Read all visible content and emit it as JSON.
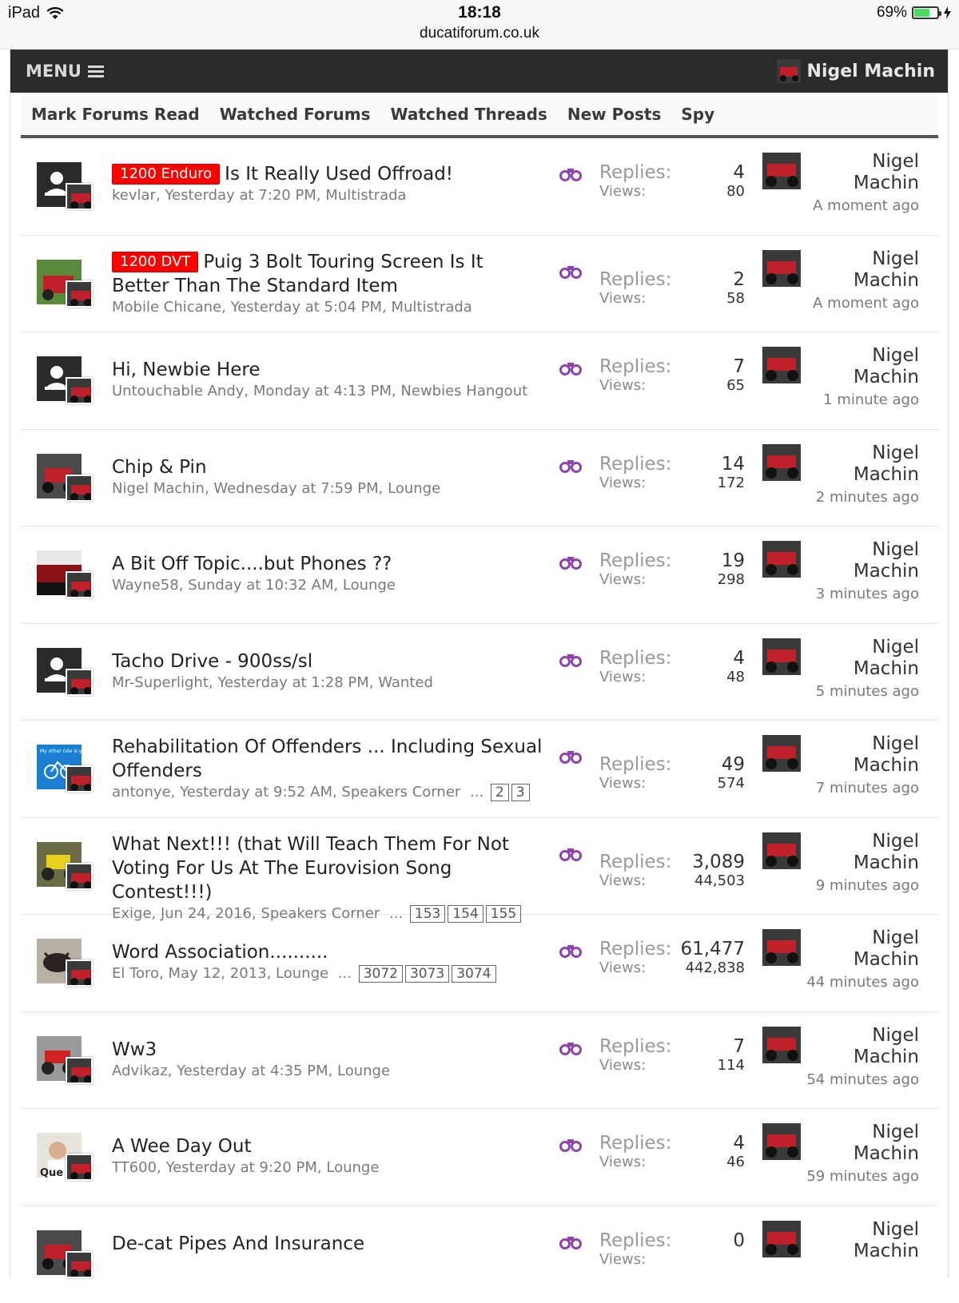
{
  "status": {
    "device": "iPad",
    "time": "18:18",
    "url": "ducatiforum.co.uk",
    "battery": "69%",
    "battery_level": 0.69
  },
  "nav": {
    "menu_label": "MENU",
    "user_name": "Nigel Machin"
  },
  "subnav": [
    "Mark Forums Read",
    "Watched Forums",
    "Watched Threads",
    "New Posts",
    "Spy"
  ],
  "labels": {
    "replies": "Replies:",
    "views": "Views:",
    "ellipsis": "..."
  },
  "threads": [
    {
      "prefix": "1200 Enduro",
      "title": "Is It Really Used Offroad!",
      "meta": "kevlar, Yesterday at 7:20 PM, Multistrada",
      "pages": [],
      "replies": "4",
      "views": "80",
      "last_first": "Nigel",
      "last_last": "Machin",
      "last_time": "A moment ago",
      "avatar": "default"
    },
    {
      "prefix": "1200 DVT",
      "title": "Puig 3 Bolt Touring Screen Is It Better Than The Standard Item",
      "meta": "Mobile Chicane, Yesterday at 5:04 PM, Multistrada",
      "pages": [],
      "replies": "2",
      "views": "58",
      "last_first": "Nigel",
      "last_last": "Machin",
      "last_time": "A moment ago",
      "avatar": "photo-green"
    },
    {
      "prefix": "",
      "title": "Hi, Newbie Here",
      "meta": "Untouchable Andy, Monday at 4:13 PM, Newbies Hangout",
      "pages": [],
      "replies": "7",
      "views": "65",
      "last_first": "Nigel",
      "last_last": "Machin",
      "last_time": "1 minute ago",
      "avatar": "default"
    },
    {
      "prefix": "",
      "title": "Chip & Pin",
      "meta": "Nigel Machin, Wednesday at 7:59 PM, Lounge",
      "pages": [],
      "replies": "14",
      "views": "172",
      "last_first": "Nigel",
      "last_last": "Machin",
      "last_time": "2 minutes ago",
      "avatar": "photo-red"
    },
    {
      "prefix": "",
      "title": "A Bit Off Topic....but Phones ??",
      "meta": "Wayne58, Sunday at 10:32 AM, Lounge",
      "pages": [],
      "replies": "19",
      "views": "298",
      "last_first": "Nigel",
      "last_last": "Machin",
      "last_time": "3 minutes ago",
      "avatar": "photo-car"
    },
    {
      "prefix": "",
      "title": "Tacho Drive - 900ss/sl",
      "meta": "Mr-Superlight, Yesterday at 1:28 PM, Wanted",
      "pages": [],
      "replies": "4",
      "views": "48",
      "last_first": "Nigel",
      "last_last": "Machin",
      "last_time": "5 minutes ago",
      "avatar": "default"
    },
    {
      "prefix": "",
      "title": "Rehabilitation Of Offenders ... Including Sexual Offenders",
      "meta": "antonye, Yesterday at 9:52 AM, Speakers Corner",
      "pages": [
        "2",
        "3"
      ],
      "replies": "49",
      "views": "574",
      "last_first": "Nigel",
      "last_last": "Machin",
      "last_time": "7 minutes ago",
      "avatar": "photo-blue",
      "avatar_text": "My other ride is your m"
    },
    {
      "prefix": "",
      "title": "What Next!!! (that Will Teach Them For Not Voting For Us At The Eurovision Song Contest!!!)",
      "meta": "Exige, Jun 24, 2016, Speakers Corner",
      "pages": [
        "153",
        "154",
        "155"
      ],
      "replies": "3,089",
      "views": "44,503",
      "last_first": "Nigel",
      "last_last": "Machin",
      "last_time": "9 minutes ago",
      "avatar": "photo-yellow"
    },
    {
      "prefix": "",
      "title": "Word Association..........",
      "meta": "El Toro, May 12, 2013, Lounge",
      "pages": [
        "3072",
        "3073",
        "3074"
      ],
      "replies": "61,477",
      "views": "442,838",
      "last_first": "Nigel",
      "last_last": "Machin",
      "last_time": "44 minutes ago",
      "avatar": "photo-bull"
    },
    {
      "prefix": "",
      "title": "Ww3",
      "meta": "Advikaz, Yesterday at 4:35 PM, Lounge",
      "pages": [],
      "replies": "7",
      "views": "114",
      "last_first": "Nigel",
      "last_last": "Machin",
      "last_time": "54 minutes ago",
      "avatar": "photo-bike"
    },
    {
      "prefix": "",
      "title": "A Wee Day Out",
      "meta": "TT600, Yesterday at 9:20 PM, Lounge",
      "pages": [],
      "replies": "4",
      "views": "46",
      "last_first": "Nigel",
      "last_last": "Machin",
      "last_time": "59 minutes ago",
      "avatar": "photo-man",
      "avatar_text": "Que"
    },
    {
      "prefix": "",
      "title": "De-cat Pipes And Insurance",
      "meta": "",
      "pages": [],
      "replies": "0",
      "views": "",
      "last_first": "Nigel",
      "last_last": "Machin",
      "last_time": "",
      "avatar": "photo-red"
    }
  ],
  "colors": {
    "prefix_bg": "#ff0000",
    "nav_bg": "#2a2a2a",
    "watch_icon": "#8e44ad",
    "battery": "#4cd964"
  }
}
